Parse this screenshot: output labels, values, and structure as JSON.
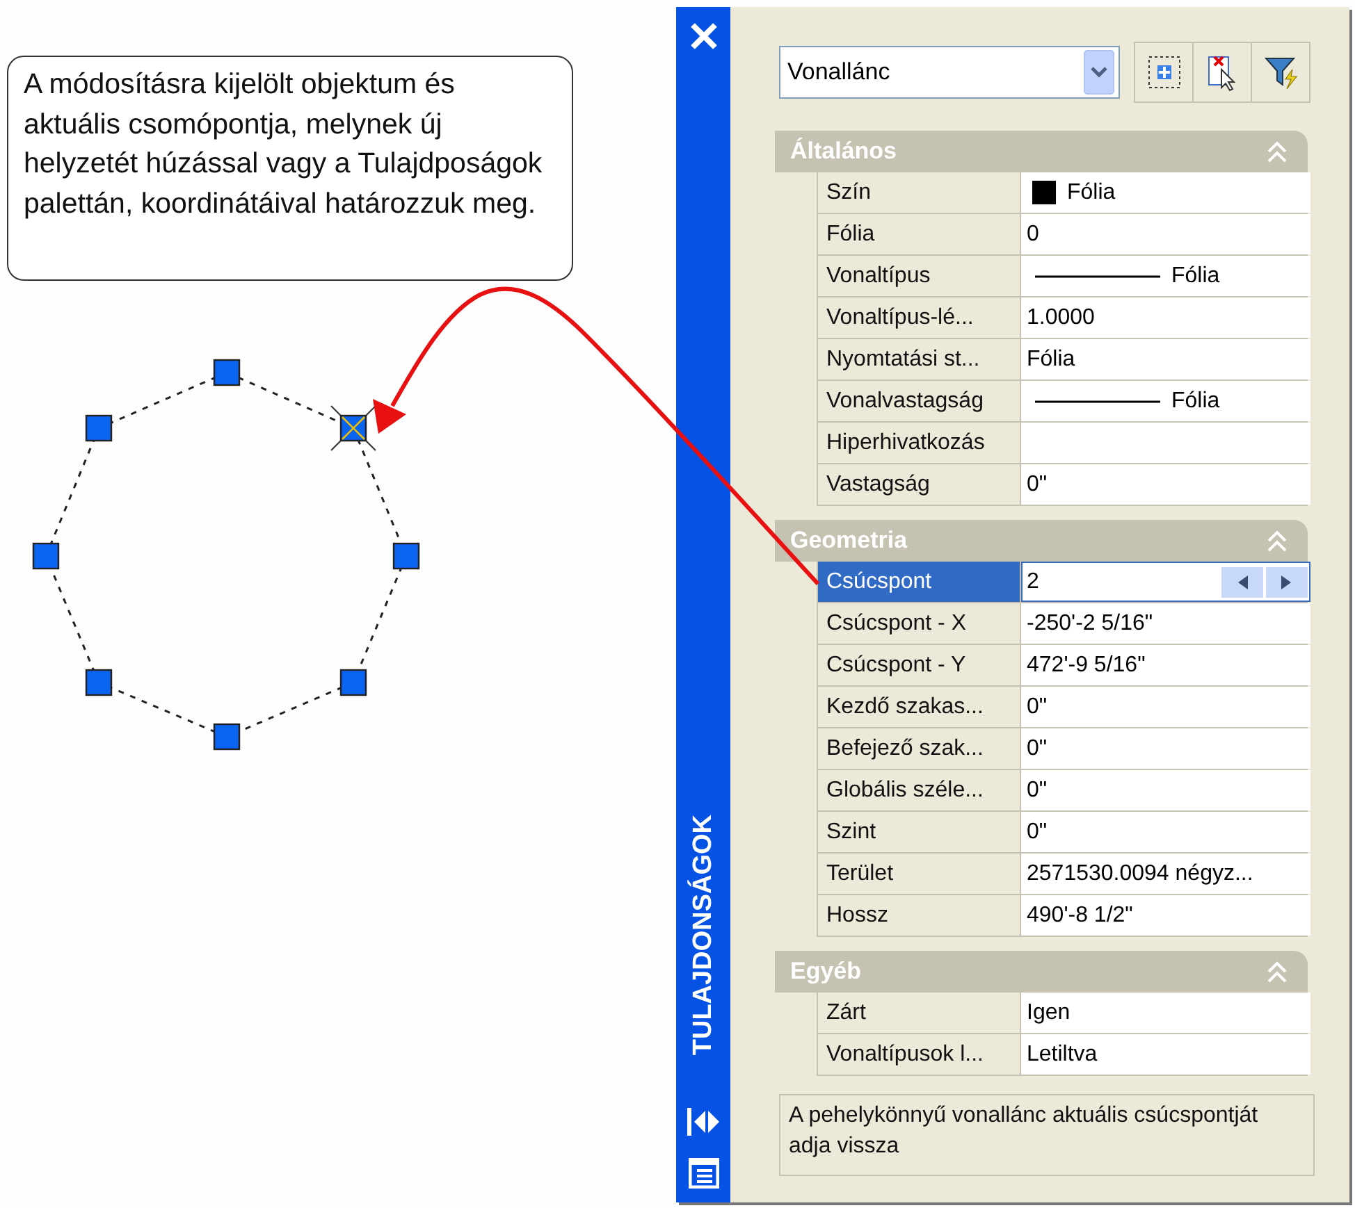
{
  "callout": {
    "text": "A módosításra kijelölt objektum és aktuális csomópontja, melynek új helyzetét húzással vagy a Tulajdposágok palettán, koordinátáival határozzuk meg."
  },
  "polyline": {
    "vertices": [
      {
        "selected": false
      },
      {
        "selected": true
      },
      {
        "selected": false
      },
      {
        "selected": false
      },
      {
        "selected": false
      },
      {
        "selected": false
      },
      {
        "selected": false
      },
      {
        "selected": false
      }
    ]
  },
  "palette": {
    "title": "TULAJDONSÁGOK",
    "object_type": "Vonallánc",
    "sections": [
      {
        "title": "Általános",
        "rows": [
          {
            "kind": "swatch",
            "label": "Szín",
            "value": "Fólia",
            "color": "#000000",
            "selected": false
          },
          {
            "kind": "text",
            "label": "Fólia",
            "value": "0",
            "selected": false
          },
          {
            "kind": "line",
            "label": "Vonaltípus",
            "value": "Fólia",
            "selected": false
          },
          {
            "kind": "text",
            "label": "Vonaltípus-lé...",
            "value": "1.0000",
            "selected": false
          },
          {
            "kind": "text",
            "label": "Nyomtatási st...",
            "value": "Fólia",
            "selected": false
          },
          {
            "kind": "line",
            "label": "Vonalvastagság",
            "value": "Fólia",
            "selected": false
          },
          {
            "kind": "text",
            "label": "Hiperhivatkozás",
            "selected": false
          },
          {
            "kind": "text",
            "label": "Vastagság",
            "value": "0\"",
            "selected": false
          }
        ]
      },
      {
        "title": "Geometria",
        "rows": [
          {
            "kind": "spinner",
            "label": "Csúcspont",
            "value": "2",
            "selected": true
          },
          {
            "kind": "text",
            "label": "Csúcspont - X",
            "value": "-250'-2 5/16\"",
            "selected": false
          },
          {
            "kind": "text",
            "label": "Csúcspont - Y",
            "value": "472'-9 5/16\"",
            "selected": false
          },
          {
            "kind": "text",
            "label": "Kezdő szakas...",
            "value": "0\"",
            "selected": false
          },
          {
            "kind": "text",
            "label": "Befejező szak...",
            "value": "0\"",
            "selected": false
          },
          {
            "kind": "text",
            "label": "Globális széle...",
            "value": "0\"",
            "selected": false
          },
          {
            "kind": "text",
            "label": "Szint",
            "value": "0\"",
            "selected": false
          },
          {
            "kind": "text",
            "label": "Terület",
            "value": "2571530.0094 négyz...",
            "selected": false
          },
          {
            "kind": "text",
            "label": "Hossz",
            "value": "490'-8 1/2\"",
            "selected": false
          }
        ]
      },
      {
        "title": "Egyéb",
        "rows": [
          {
            "kind": "text",
            "label": "Zárt",
            "value": "Igen",
            "selected": false
          },
          {
            "kind": "text",
            "label": "Vonaltípusok l...",
            "value": "Letiltva",
            "selected": false
          }
        ]
      }
    ],
    "description": "A pehelykönnyű vonallánc aktuális csúcspontját adja vissza"
  }
}
